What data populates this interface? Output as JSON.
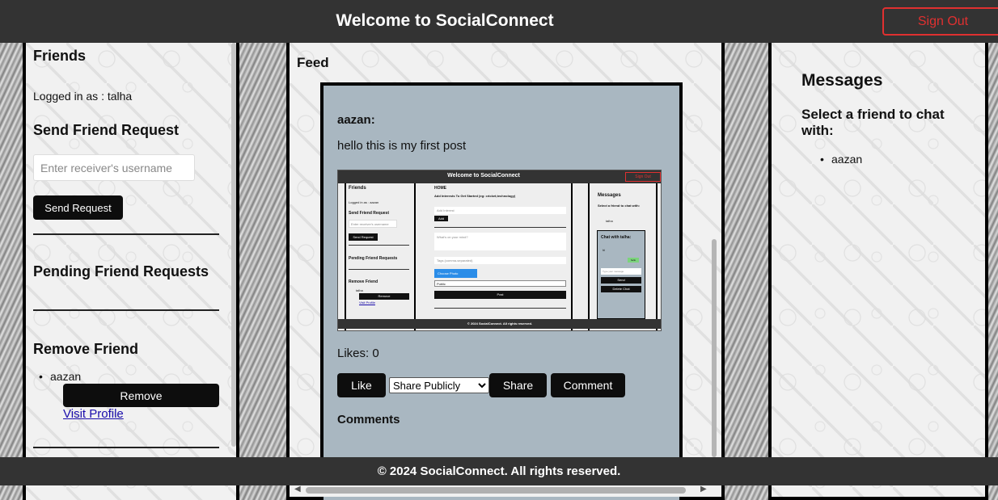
{
  "header": {
    "title": "Welcome to SocialConnect",
    "sign_out": "Sign Out"
  },
  "friends_panel": {
    "title": "Friends",
    "logged_in": "Logged in as : talha",
    "send_request_title": "Send Friend Request",
    "receiver_placeholder": "Enter receiver's username",
    "send_button": "Send Request",
    "pending_title": "Pending Friend Requests",
    "remove_title": "Remove Friend",
    "friends": [
      {
        "name": "aazan",
        "remove_label": "Remove",
        "visit_label": "Visit Profile"
      }
    ]
  },
  "feed": {
    "title": "Feed",
    "post": {
      "author": "aazan:",
      "text": "hello this is my first post",
      "image_alt": "screenshot",
      "likes": "Likes: 0",
      "like_button": "Like",
      "share_select": "Share Publicly",
      "share_button": "Share",
      "comment_button": "Comment",
      "comments_title": "Comments"
    }
  },
  "messages_panel": {
    "title": "Messages",
    "subtitle": "Select a friend to chat with:",
    "friends": [
      "aazan"
    ]
  },
  "footer": {
    "text": "© 2024 SocialConnect. All rights reserved."
  },
  "mini_screenshot": {
    "header": "Welcome to SocialConnect",
    "sign_out": "Sign Out",
    "friends": "Friends",
    "logged": "Logged in as : aazan",
    "send_title": "Send Friend Request",
    "placeholder": "Enter receiver's username",
    "send_btn": "Send Request",
    "pending": "Pending Friend Requests",
    "remove": "Remove Friend",
    "friend": "talha",
    "remove_btn": "Remove",
    "visit": "Visit Profile",
    "home": "HOME",
    "interests": "Add Interests To Get Started (eg: cricket,technology)",
    "add_interest": "Add Interest",
    "add": "Add",
    "whats": "What's on your mind?",
    "tags": "Tags (comma-separated)",
    "choose": "Choose Photo",
    "public": "Public",
    "post": "Post",
    "messages": "Messages",
    "select": "Select a friend to chat with:",
    "chat_friend": "talha",
    "chat_with": "Chat with talha:",
    "hi": "hi",
    "hello": "hello",
    "type_msg": "Type your message",
    "send": "Send",
    "delete_chat": "Delete Chat",
    "footer": "© 2024 SocialConnect. All rights reserved."
  }
}
